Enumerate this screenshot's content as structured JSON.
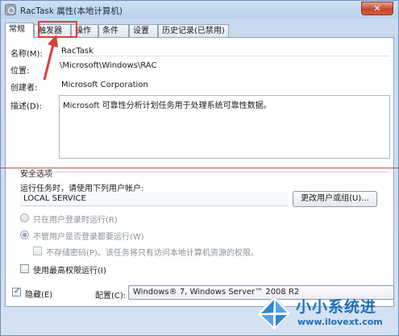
{
  "window": {
    "title": "RacTask 属性(本地计算机)",
    "close_glyph": "✕"
  },
  "tabs": [
    {
      "label": "常规"
    },
    {
      "label": "触发器"
    },
    {
      "label": "操作"
    },
    {
      "label": "条件"
    },
    {
      "label": "设置"
    },
    {
      "label": "历史记录(已禁用)"
    }
  ],
  "general": {
    "name_label": "名称(M):",
    "name_value": "RacTask",
    "location_label": "位置:",
    "location_value": "\\Microsoft\\Windows\\RAC",
    "author_label": "创建者:",
    "author_value": "Microsoft Corporation",
    "description_label": "描述(D):",
    "description_value": "Microsoft 可靠性分析计划任务用于处理系统可靠性数据。"
  },
  "security": {
    "group_label": "安全选项",
    "run_as_label": "运行任务时，请使用下列用户帐户:",
    "account_value": "LOCAL SERVICE",
    "change_button": "更改用户或组(U)...",
    "radio_logged_on": "只在用户登录时运行(R)",
    "radio_any": "不管用户是否登录都要运行(W)",
    "no_store_password": "不存储密码(P)。该任务将只有访问本地计算机资源的权限。",
    "highest_privileges": "使用最高权限运行(I)"
  },
  "footer": {
    "hidden_label": "隐藏(E)",
    "configure_label": "配置(C):",
    "configure_value": "Windows® 7, Windows Server™ 2008 R2"
  },
  "watermark": {
    "brand": "小小系统进",
    "url": "www.ilovext.com"
  },
  "colors": {
    "highlight": "#e23b3b",
    "brand": "#1f6fb8"
  }
}
